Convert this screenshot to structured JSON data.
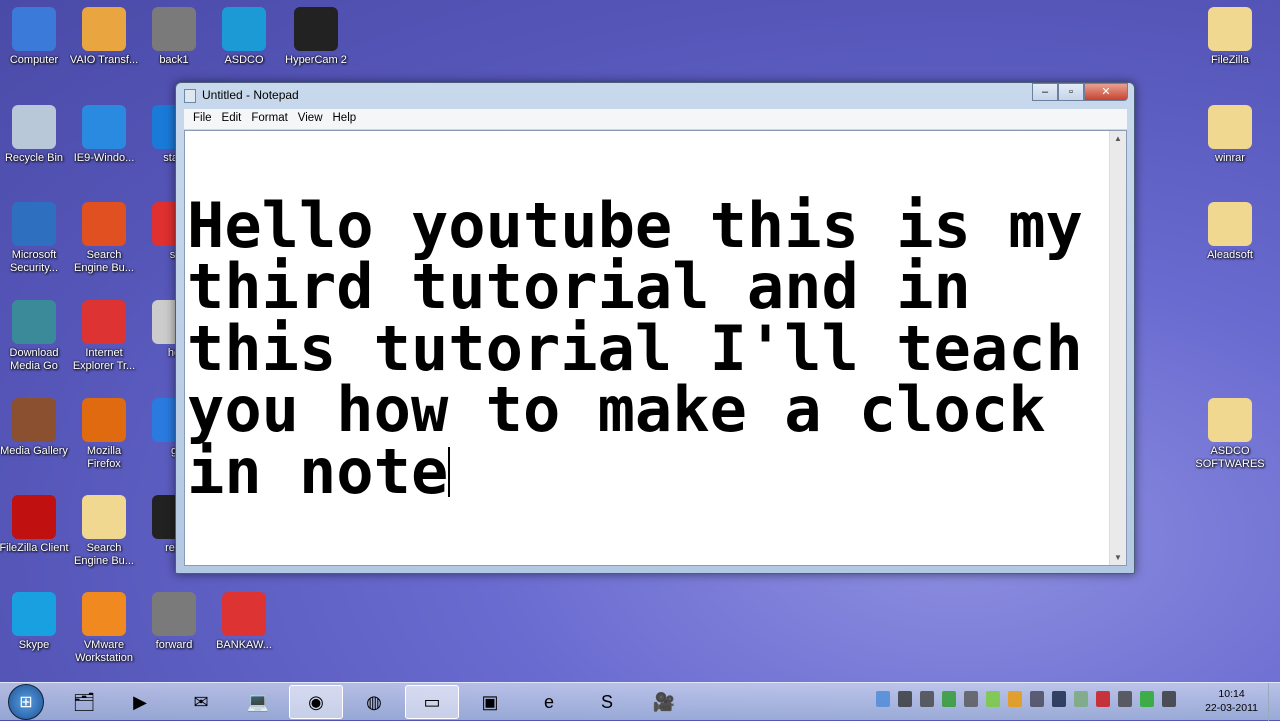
{
  "desktop_icons": [
    {
      "label": "Computer",
      "icon": "computer-icon",
      "color": "#3b7ad8"
    },
    {
      "label": "VAIO Transf...",
      "icon": "box-icon",
      "color": "#e8a540"
    },
    {
      "label": "back1",
      "icon": "arrow-left-icon",
      "color": "#7a7a7a"
    },
    {
      "label": "ASDCO",
      "icon": "asdco-icon",
      "color": "#1c9ad6"
    },
    {
      "label": "HyperCam 2",
      "icon": "camera-icon",
      "color": "#222"
    },
    {
      "label": "Recycle Bin",
      "icon": "recycle-bin-icon",
      "color": "#b8c8d8"
    },
    {
      "label": "IE9-Windo...",
      "icon": "ie-icon",
      "color": "#2a8ae0"
    },
    {
      "label": "start",
      "icon": "start-icon",
      "color": "#1a7ad8"
    },
    {
      "label": "Microsoft Security...",
      "icon": "castle-icon",
      "color": "#2f6fc0"
    },
    {
      "label": "Search Engine Bu...",
      "icon": "crab-icon",
      "color": "#e05020"
    },
    {
      "label": "st",
      "icon": "red-arrow-icon",
      "color": "#e03030"
    },
    {
      "label": "Download Media Go",
      "icon": "media-go-icon",
      "color": "#3a8a9a"
    },
    {
      "label": "Internet Explorer Tr...",
      "icon": "chrome-icon",
      "color": "#d33"
    },
    {
      "label": "ho",
      "icon": "pen-icon",
      "color": "#ccc"
    },
    {
      "label": "Media Gallery",
      "icon": "media-gallery-icon",
      "color": "#8a5030"
    },
    {
      "label": "Mozilla Firefox",
      "icon": "firefox-icon",
      "color": "#e06a10"
    },
    {
      "label": "g",
      "icon": "g-icon",
      "color": "#2a7ae0"
    },
    {
      "label": "FileZilla Client",
      "icon": "filezilla-icon",
      "color": "#c01010"
    },
    {
      "label": "Search Engine Bu...",
      "icon": "folder-icon",
      "color": "#f0d890"
    },
    {
      "label": "relc",
      "icon": "reload-icon",
      "color": "#222"
    },
    {
      "label": "Skype",
      "icon": "skype-icon",
      "color": "#18a0e0"
    },
    {
      "label": "VMware Workstation",
      "icon": "vmware-icon",
      "color": "#f08a20"
    },
    {
      "label": "forward",
      "icon": "arrow-right-icon",
      "color": "#7a7a7a"
    },
    {
      "label": "BANKAW...",
      "icon": "chrome-icon",
      "color": "#d33"
    },
    {
      "label": "FileZilla",
      "icon": "folder-icon",
      "color": "#f0d890"
    },
    {
      "label": "winrar",
      "icon": "folder-icon",
      "color": "#f0d890"
    },
    {
      "label": "Aleadsoft",
      "icon": "folder-icon",
      "color": "#f0d890"
    },
    {
      "label": "ASDCO SOFTWARES",
      "icon": "folder-icon",
      "color": "#f0d890"
    }
  ],
  "notepad": {
    "title": "Untitled - Notepad",
    "menu": [
      "File",
      "Edit",
      "Format",
      "View",
      "Help"
    ],
    "lines": [
      "Hello youtube this is my",
      "third tutorial and in",
      "this tutorial I'll teach",
      "you how to make a clock",
      "in note"
    ]
  },
  "taskbar": {
    "items": [
      {
        "name": "explorer",
        "glyph": "🗂"
      },
      {
        "name": "media-player",
        "glyph": "▶"
      },
      {
        "name": "outlook",
        "glyph": "✉"
      },
      {
        "name": "network-tool",
        "glyph": "💻"
      },
      {
        "name": "chrome",
        "glyph": "◉",
        "active": true
      },
      {
        "name": "firefox",
        "glyph": "◍"
      },
      {
        "name": "notepad",
        "glyph": "▭",
        "active": true
      },
      {
        "name": "vmware",
        "glyph": "▣"
      },
      {
        "name": "internet-explorer",
        "glyph": "e"
      },
      {
        "name": "skype",
        "glyph": "S"
      },
      {
        "name": "hypercam",
        "glyph": "🎥"
      }
    ],
    "tray_icons": [
      "network-icon",
      "devices-icon",
      "volume-icon",
      "security-icon",
      "power-icon",
      "shield-icon",
      "flash-icon",
      "laptop-icon",
      "bluetooth-icon",
      "check-icon",
      "ati-icon",
      "flag-icon",
      "sync-icon",
      "signal-icon"
    ],
    "time": "10:14",
    "date": "22-03-2011"
  }
}
